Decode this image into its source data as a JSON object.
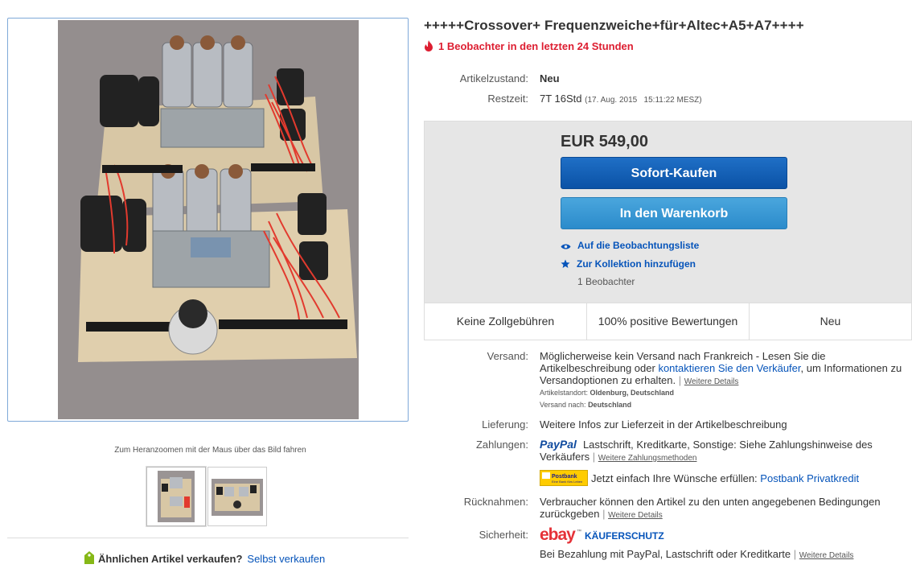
{
  "gallery": {
    "zoom_hint": "Zum Heranzoomen mit der Maus über das Bild fahren"
  },
  "sell_similar": {
    "question": "Ähnlichen Artikel verkaufen?",
    "link": "Selbst verkaufen"
  },
  "listing": {
    "title": "+++++Crossover+ Frequenzweiche+für+Altec+A5+A7++++",
    "watchers_hot": "1 Beobachter in den letzten 24 Stunden",
    "condition_label": "Artikelzustand:",
    "condition_value": "Neu",
    "time_label": "Restzeit:",
    "time_value": "7T 16Std",
    "time_end": "(17. Aug. 2015   15:11:22 MESZ)"
  },
  "buybox": {
    "price": "EUR 549,00",
    "buy_now": "Sofort-Kaufen",
    "add_to_cart": "In den Warenkorb",
    "watch": "Auf die Beobachtungsliste",
    "collection": "Zur Kollektion hinzufügen",
    "watch_count": "1 Beobachter"
  },
  "features": [
    "Keine Zollgebühren",
    "100% positive Bewertungen",
    "Neu"
  ],
  "shipping": {
    "label": "Versand:",
    "text_1": "Möglicherweise kein Versand nach Frankreich - Lesen Sie die",
    "text_2": "Artikelbeschreibung oder",
    "contact_link": "kontaktieren Sie den Verkäufer",
    "text_3": ", um Informationen zu",
    "text_4": "Versandoptionen zu erhalten.",
    "more": "Weitere Details",
    "location_label": "Artikelstandort:",
    "location_value": "Oldenburg, Deutschland",
    "ships_to_label": "Versand nach:",
    "ships_to_value": "Deutschland"
  },
  "delivery": {
    "label": "Lieferung:",
    "value": "Weitere Infos zur Lieferzeit in der Artikelbeschreibung"
  },
  "payments": {
    "label": "Zahlungen:",
    "paypal": "PayPal",
    "methods_1": "Lastschrift,  Kreditkarte,  Sonstige: Siehe Zahlungshinweise des",
    "methods_2": "Verkäufers",
    "more": "Weitere Zahlungsmethoden",
    "postbank_logo": "Postbank",
    "postbank_tagline": "Eine Bank fürs Leben",
    "postbank_text": "Jetzt einfach Ihre Wünsche erfüllen:",
    "postbank_link": "Postbank Privatkredit"
  },
  "returns": {
    "label": "Rücknahmen:",
    "text_1": "Verbraucher können den Artikel zu den unten angegebenen Bedingungen",
    "text_2": "zurückgeben",
    "more": "Weitere Details"
  },
  "security": {
    "label": "Sicherheit:",
    "logo": "ebay",
    "logo_tm": "™",
    "protection": "KÄUFERSCHUTZ",
    "text": "Bei Bezahlung mit PayPal, Lastschrift oder Kreditkarte",
    "more": "Weitere Details"
  },
  "colors": {
    "link": "#0654ba",
    "alert": "#dd1e31",
    "buy_now": "#0b52a6",
    "add_cart": "#2b8bcb"
  }
}
